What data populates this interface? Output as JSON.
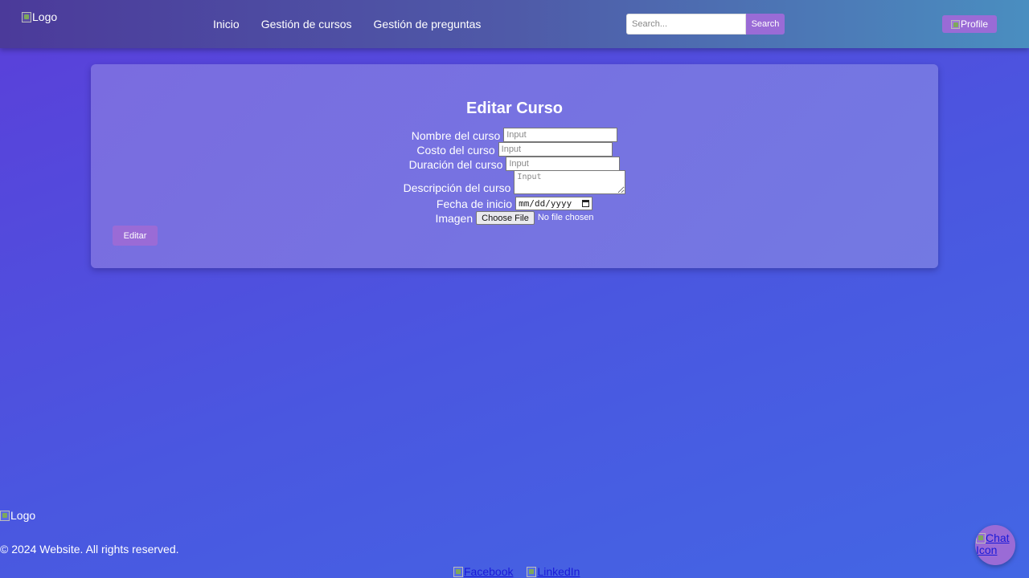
{
  "header": {
    "logo_alt": "Logo",
    "nav": {
      "home": "Inicio",
      "courses": "Gestión de cursos",
      "questions": "Gestión de preguntas"
    },
    "search": {
      "placeholder": "Search...",
      "button": "Search"
    },
    "profile_alt": "Profile"
  },
  "form": {
    "title": "Editar Curso",
    "fields": {
      "name": {
        "label": "Nombre del curso",
        "placeholder": "Input"
      },
      "cost": {
        "label": "Costo del curso",
        "placeholder": "Input"
      },
      "duration": {
        "label": "Duración del curso",
        "placeholder": "Input"
      },
      "description": {
        "label": "Descripción del curso",
        "placeholder": "Input"
      },
      "start_date": {
        "label": "Fecha de inicio",
        "value": "mm/dd/yyyy"
      },
      "image": {
        "label": "Imagen",
        "button": "Choose File",
        "status": "No file chosen"
      }
    },
    "submit": "Editar"
  },
  "footer": {
    "logo_alt": "Logo",
    "copyright": "© 2024 Website. All rights reserved.",
    "social": {
      "facebook": "Facebook",
      "linkedin": "LinkedIn"
    },
    "chat_alt": "Chat Icon"
  },
  "colors": {
    "accent": "#9a6bd6",
    "background": "#4a57e0",
    "card": "#7773e1"
  }
}
